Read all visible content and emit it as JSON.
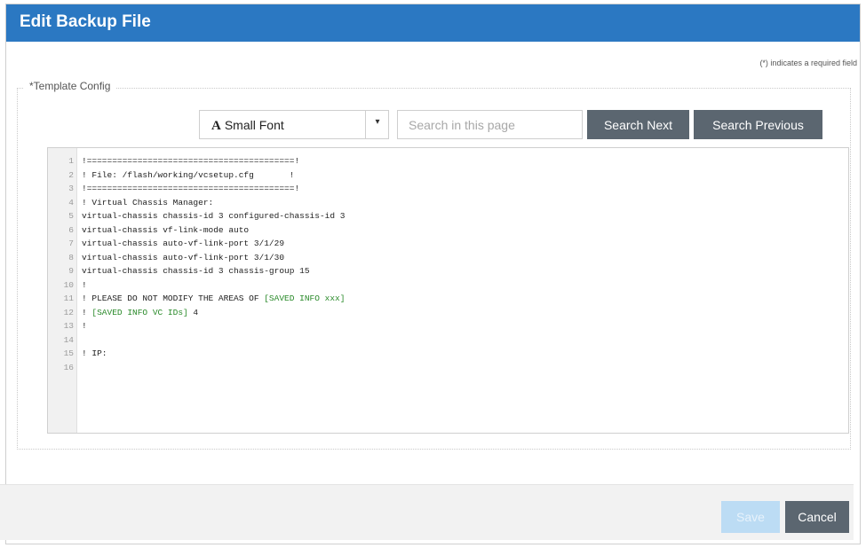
{
  "dialog": {
    "title": "Edit Backup File",
    "required_note": "(*) indicates a required field"
  },
  "section": {
    "legend": "*Template Config"
  },
  "toolbar": {
    "font_icon": "A",
    "font_select": "Small Font",
    "caret": "▾",
    "search_placeholder": "Search in this page",
    "search_value": "",
    "search_next": "Search Next",
    "search_previous": "Search Previous"
  },
  "editor": {
    "lines": [
      {
        "n": "1",
        "text": "!=========================================!"
      },
      {
        "n": "2",
        "text": "! File: /flash/working/vcsetup.cfg       !"
      },
      {
        "n": "3",
        "text": "!=========================================!"
      },
      {
        "n": "4",
        "text": "! Virtual Chassis Manager:"
      },
      {
        "n": "5",
        "text": "virtual-chassis chassis-id 3 configured-chassis-id 3"
      },
      {
        "n": "6",
        "text": "virtual-chassis vf-link-mode auto"
      },
      {
        "n": "7",
        "text": "virtual-chassis auto-vf-link-port 3/1/29"
      },
      {
        "n": "8",
        "text": "virtual-chassis auto-vf-link-port 3/1/30"
      },
      {
        "n": "9",
        "text": "virtual-chassis chassis-id 3 chassis-group 15"
      },
      {
        "n": "10",
        "text": "!"
      },
      {
        "n": "11",
        "text": "! PLEASE DO NOT MODIFY THE AREAS OF ",
        "green": "[SAVED INFO xxx]",
        "after": ""
      },
      {
        "n": "12",
        "text": "! ",
        "green": "[SAVED INFO VC IDs]",
        "after": " 4"
      },
      {
        "n": "13",
        "text": "!"
      },
      {
        "n": "14",
        "text": ""
      },
      {
        "n": "15",
        "text": "! IP:"
      },
      {
        "n": "16",
        "text": ""
      }
    ]
  },
  "footer": {
    "save": "Save",
    "cancel": "Cancel"
  },
  "colors": {
    "header": "#2b78c2",
    "button": "#5b6670",
    "save_disabled": "#bcdcf4",
    "code_green": "#2a8a2a"
  }
}
